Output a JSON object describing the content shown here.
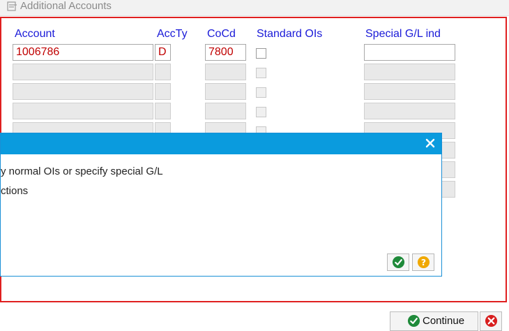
{
  "window": {
    "title": "Additional Accounts",
    "title_icon": "document-edit-icon"
  },
  "columns": {
    "account": "Account",
    "acc_ty": "AccTy",
    "co_cd": "CoCd",
    "standard_ois": "Standard OIs",
    "special_gl_ind": "Special G/L ind"
  },
  "row1": {
    "account": "1006786",
    "acc_ty": "D",
    "co_cd": "7800",
    "standard_ois_checked": false,
    "special_gl_ind": ""
  },
  "popup": {
    "line1": "y normal OIs or specify special G/L",
    "line2": "ctions",
    "close_icon": "close-icon",
    "confirm_icon": "checkmark-icon",
    "help_icon": "question-icon"
  },
  "footer": {
    "continue_label": "Continue",
    "continue_icon": "checkmark-icon",
    "cancel_icon": "cancel-icon"
  },
  "colors": {
    "frame_border": "#e02020",
    "header_text": "#1a1ad8",
    "value_text": "#c00000",
    "popup_bar": "#0a9bde"
  }
}
